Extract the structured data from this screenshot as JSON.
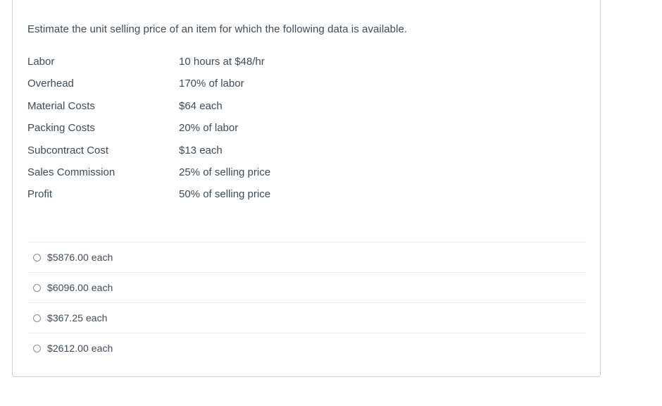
{
  "question": {
    "prompt": "Estimate the unit selling price of an item for which the following data is available.",
    "data_rows": [
      {
        "label": "Labor",
        "value": "10 hours at $48/hr"
      },
      {
        "label": "Overhead",
        "value": "170% of labor"
      },
      {
        "label": "Material Costs",
        "value": "$64 each"
      },
      {
        "label": "Packing Costs",
        "value": "20% of labor"
      },
      {
        "label": "Subcontract Cost",
        "value": "$13 each"
      },
      {
        "label": "Sales Commission",
        "value": "25% of selling price"
      },
      {
        "label": "Profit",
        "value": "50% of selling price"
      }
    ],
    "options": [
      {
        "label": "$5876.00 each",
        "selected": false
      },
      {
        "label": "$6096.00 each",
        "selected": false
      },
      {
        "label": "$367.25 each",
        "selected": false
      },
      {
        "label": "$2612.00 each",
        "selected": false
      }
    ]
  },
  "colors": {
    "text": "#3e4a56",
    "card_border": "#d0d0d4",
    "separator": "#ececee",
    "radio_border": "#8b8b90",
    "background": "#ffffff"
  }
}
